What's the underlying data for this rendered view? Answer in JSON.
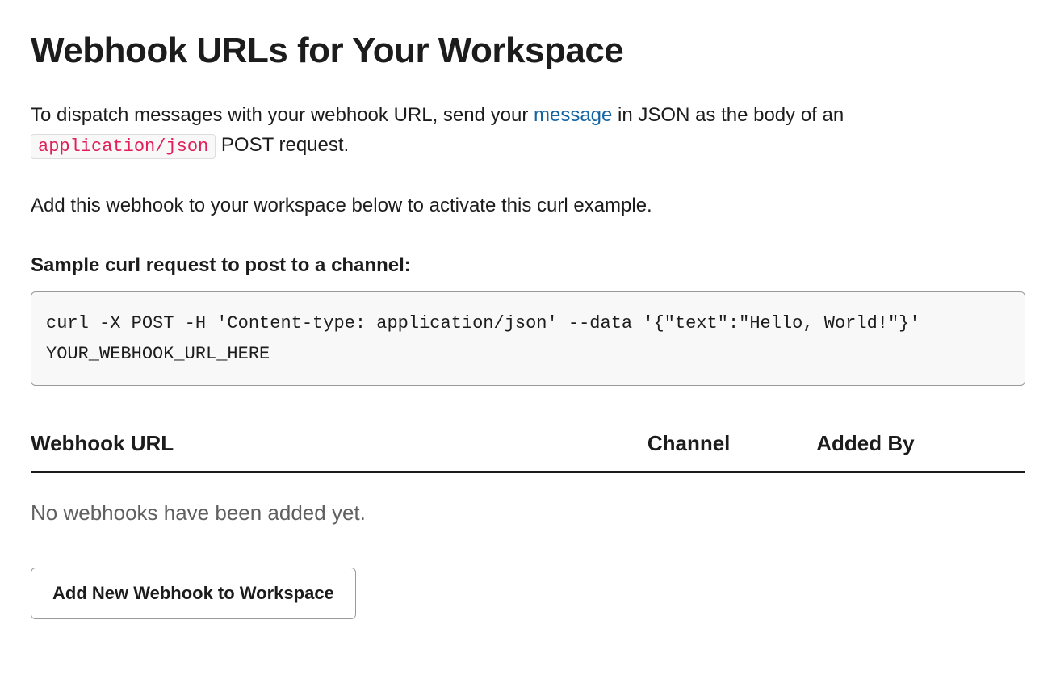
{
  "heading": "Webhook URLs for Your Workspace",
  "intro": {
    "part1": "To dispatch messages with your webhook URL, send your ",
    "link_text": "message",
    "part2": " in JSON as the body of an ",
    "code_inline": "application/json",
    "part3": " POST request."
  },
  "instruction": "Add this webhook to your workspace below to activate this curl example.",
  "sample_label": "Sample curl request to post to a channel:",
  "curl_command": "curl -X POST -H 'Content-type: application/json' --data '{\"text\":\"Hello, World!\"}' YOUR_WEBHOOK_URL_HERE",
  "table": {
    "columns": {
      "url": "Webhook URL",
      "channel": "Channel",
      "added_by": "Added By"
    },
    "empty_message": "No webhooks have been added yet."
  },
  "add_button_label": "Add New Webhook to Workspace"
}
